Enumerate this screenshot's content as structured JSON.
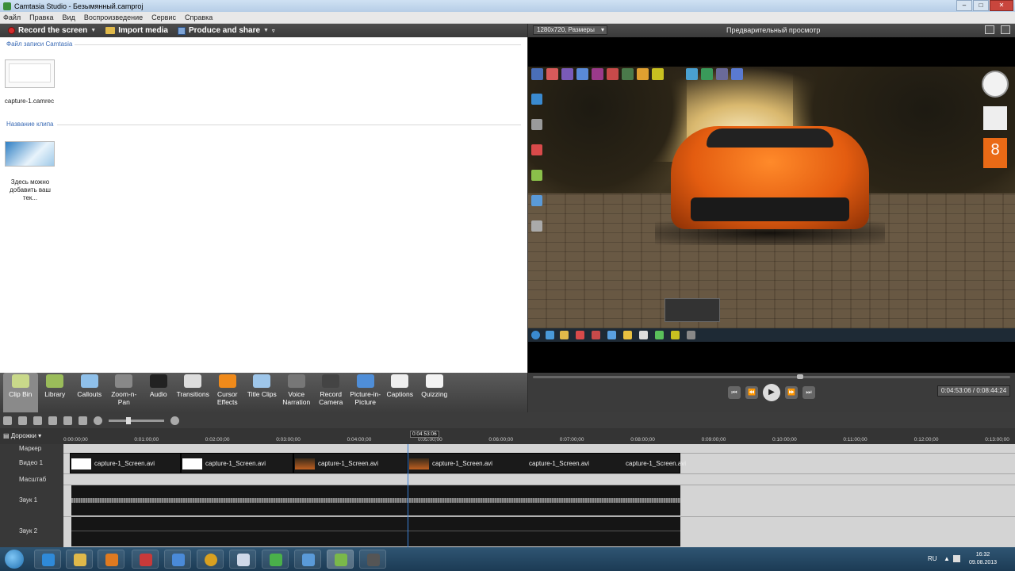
{
  "window": {
    "title": "Camtasia Studio - Безымянный.camproj",
    "controls": [
      "–",
      "□",
      "✕"
    ]
  },
  "menu": [
    "Файл",
    "Правка",
    "Вид",
    "Воспроизведение",
    "Сервис",
    "Справка"
  ],
  "toolbar": {
    "record_label": "Record the screen",
    "import_label": "Import media",
    "produce_label": "Produce and share"
  },
  "clip_bin": {
    "section_recordings": "Файл записи Camtasia",
    "recording_name": "capture-1.camrec",
    "section_clips": "Название клипа",
    "clip_name_line1": "Здесь можно",
    "clip_name_line2": "добавить ваш тек..."
  },
  "task_tabs": [
    {
      "label": "Clip Bin",
      "icon": "clip-bin-icon",
      "color": "#c9d98a"
    },
    {
      "label": "Library",
      "icon": "library-icon",
      "color": "#9abc5a"
    },
    {
      "label": "Callouts",
      "icon": "callouts-icon",
      "color": "#8fc0ea"
    },
    {
      "label": "Zoom-n-Pan",
      "icon": "zoom-icon",
      "color": "#888888"
    },
    {
      "label": "Audio",
      "icon": "audio-icon",
      "color": "#222222"
    },
    {
      "label": "Transitions",
      "icon": "transitions-icon",
      "color": "#dddddd"
    },
    {
      "label": "Cursor Effects",
      "icon": "cursor-icon",
      "color": "#f08a1a"
    },
    {
      "label": "Title Clips",
      "icon": "title-icon",
      "color": "#9ec6ea"
    },
    {
      "label": "Voice Narration",
      "icon": "microphone-icon",
      "color": "#777777"
    },
    {
      "label": "Record Camera",
      "icon": "camera-icon",
      "color": "#444444"
    },
    {
      "label": "Picture-in-Picture",
      "icon": "pip-icon",
      "color": "#4f8ed8"
    },
    {
      "label": "Captions",
      "icon": "cc-icon",
      "color": "#eeeeee"
    },
    {
      "label": "Quizzing",
      "icon": "quiz-icon",
      "color": "#f3f3f3"
    }
  ],
  "preview": {
    "dimensions": "1280x720, Размеры",
    "title": "Предварительный просмотр",
    "desktop_date_gadget": "8"
  },
  "player": {
    "timecode": "0:04:53:06 / 0:08:44:24",
    "progress_fraction": 0.56
  },
  "timeline": {
    "tracks_button": "Дорожки",
    "playhead_time": "0:04:53:06",
    "ruler_ticks": [
      "0:00:00;00",
      "0:01:00;00",
      "0:02:00;00",
      "0:03:00;00",
      "0:04:00;00",
      "0:05:00;00",
      "0:06:00;00",
      "0:07:00;00",
      "0:08:00;00",
      "0:09:00;00",
      "0:10:00;00",
      "0:11:00;00",
      "0:12:00;00",
      "0:13:00;00"
    ],
    "track_labels": {
      "marker": "Маркер",
      "video": "Видео 1",
      "zoom": "Масштаб",
      "audio1": "Звук 1",
      "audio2": "Звук 2"
    },
    "video_clips": [
      "capture-1_Screen.avi",
      "capture-1_Screen.avi",
      "capture-1_Screen.avi",
      "capture-1_Screen.avi",
      "capture-1_Screen.avi",
      "capture-1_Screen.avi"
    ]
  },
  "taskbar": {
    "language": "RU",
    "time": "16:32",
    "date": "09.08.2013"
  }
}
